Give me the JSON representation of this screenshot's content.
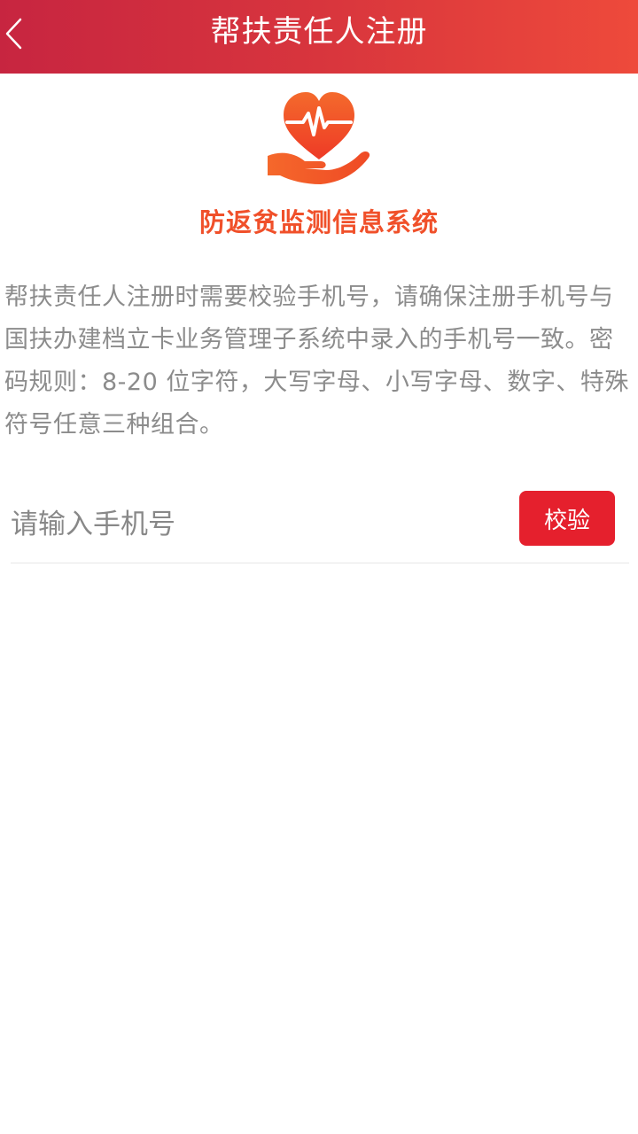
{
  "header": {
    "title": "帮扶责任人注册",
    "back_icon": "chevron-left-icon"
  },
  "logo": {
    "icon": "heart-in-hand-icon",
    "app_name": "防返贫监测信息系统"
  },
  "notice": {
    "text": "帮扶责任人注册时需要校验手机号，请确保注册手机号与国扶办建档立卡业务管理子系统中录入的手机号一致。密码规则：8-20 位字符，大写字母、小写字母、数字、特殊符号任意三种组合。"
  },
  "form": {
    "phone": {
      "placeholder": "请输入手机号",
      "value": ""
    },
    "verify_label": "校验"
  },
  "colors": {
    "header_start": "#c72540",
    "header_end": "#ee4a3b",
    "accent": "#e5202d",
    "app_name": "#f0502a",
    "notice_text": "#8c8c8c"
  }
}
